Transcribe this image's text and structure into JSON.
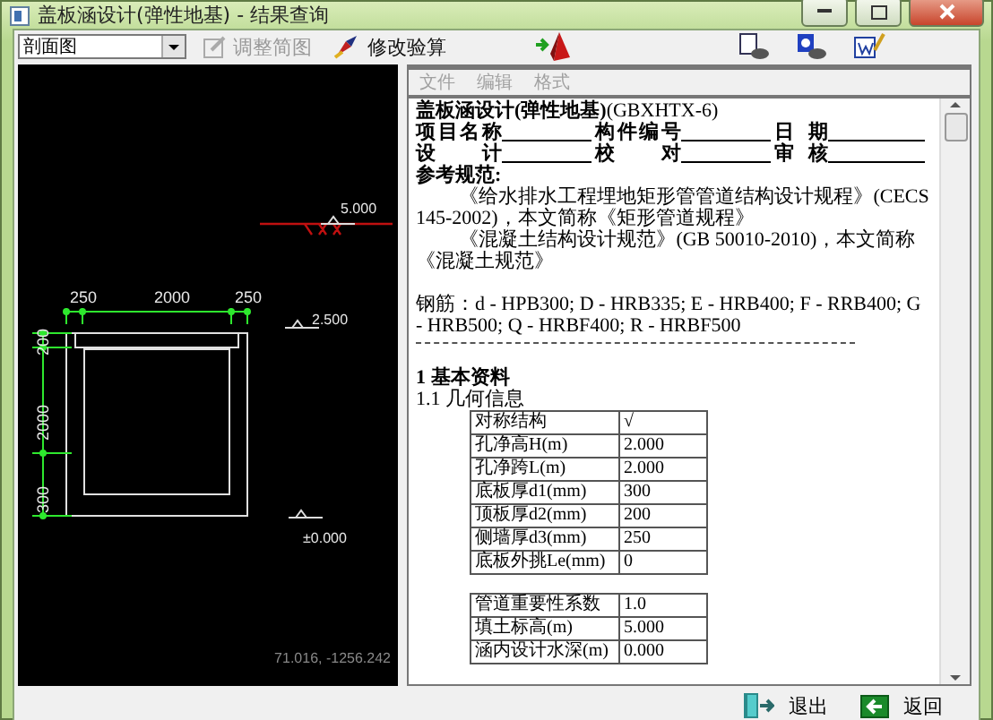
{
  "window": {
    "title": "盖板涵设计(弹性地基) - 结果查询"
  },
  "toolbar": {
    "view_select": {
      "value": "剖面图"
    },
    "buttons": [
      {
        "kind": "adjust",
        "label": "调整简图",
        "disabled": true
      },
      {
        "kind": "check",
        "label": "修改验算",
        "disabled": false
      }
    ]
  },
  "drawing": {
    "labels": [
      {
        "kind": "dim_h",
        "text": "250"
      },
      {
        "kind": "dim_h",
        "text": "2000"
      },
      {
        "kind": "dim_h",
        "text": "250"
      },
      {
        "kind": "dim_v",
        "text": "200"
      },
      {
        "kind": "dim_v",
        "text": "2000"
      },
      {
        "kind": "dim_v",
        "text": "300"
      },
      {
        "kind": "elevation",
        "text": "5.000"
      },
      {
        "kind": "elevation",
        "text": "2.500"
      },
      {
        "kind": "elevation",
        "text": "±0.000"
      }
    ],
    "coordinates": "71.016, -1256.242"
  },
  "document": {
    "menu": [
      {
        "label": "文件",
        "disabled": true
      },
      {
        "label": "编辑",
        "disabled": true
      },
      {
        "label": "格式",
        "disabled": true
      }
    ],
    "title": "**盖板涵设计(弹性地基)**(GBXHTX-6)",
    "header_rows": [
      [
        {
          "label": "项目名称"
        },
        {
          "label": "构件编号"
        },
        {
          "label": "日 期"
        }
      ],
      [
        {
          "label": "设 计"
        },
        {
          "label": "校 对"
        },
        {
          "label": "审 核"
        }
      ]
    ],
    "references_heading": "参考规范:",
    "references": [
      "《给水排水工程埋地矩形管管道结构设计规程》(CECS 145-2002)，本文简称《矩形管道规程》",
      "《混凝土结构设计规范》(GB 50010-2010)，本文简称《混凝土规范》"
    ],
    "rebar": "钢筋：d - HPB300; D - HRB335; E - HRB400; F - RRB400; G - HRB500; Q - HRBF400; R - HRBF500",
    "section": "1  基本资料",
    "subsection": "1.1  几何信息",
    "tables": [
      [
        [
          "对称结构",
          "√"
        ],
        [
          "孔净高H(m)",
          "2.000"
        ],
        [
          "孔净跨L(m)",
          "2.000"
        ],
        [
          "底板厚d1(mm)",
          "300"
        ],
        [
          "顶板厚d2(mm)",
          "200"
        ],
        [
          "侧墙厚d3(mm)",
          "250"
        ],
        [
          "底板外挑Le(mm)",
          "0"
        ]
      ],
      [
        [
          "管道重要性系数",
          "1.0"
        ],
        [
          "填土标高(m)",
          "5.000"
        ],
        [
          "涵内设计水深(m)",
          "0.000"
        ]
      ]
    ]
  },
  "footer": {
    "buttons": [
      {
        "kind": "exit",
        "label": "退出"
      },
      {
        "kind": "back",
        "label": "返回"
      }
    ]
  }
}
